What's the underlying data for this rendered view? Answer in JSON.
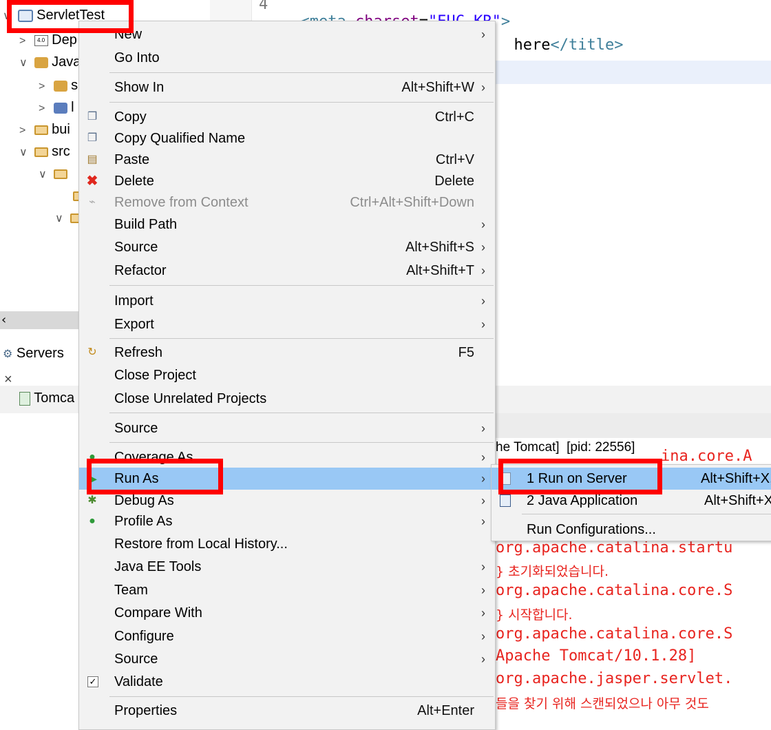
{
  "editor": {
    "line_number": "4",
    "line4_parts": [
      "<",
      "meta",
      " charset",
      "=",
      "\"EUC-KR\"",
      ">"
    ],
    "line5_parts": [
      "here",
      "</",
      "title",
      ">"
    ]
  },
  "tree": {
    "project": "ServletTest",
    "items": [
      {
        "label": "Dep",
        "chevron": ">"
      },
      {
        "label": "Java",
        "chevron": "∨"
      },
      {
        "label": "s",
        "chevron": ">"
      },
      {
        "label": "l",
        "chevron": ">"
      },
      {
        "label": "bui",
        "chevron": ">"
      },
      {
        "label": "src",
        "chevron": "∨"
      },
      {
        "label": "",
        "chevron": "∨"
      }
    ]
  },
  "servers_tab": {
    "label": "Servers",
    "close": "×"
  },
  "servers_view": {
    "item": "Tomca"
  },
  "console": {
    "header": "he Tomcat]  [pid: 22556]",
    "header_partial": "ina.core.A",
    "lines": [
      {
        "text": "org.apache.catalina.startu",
        "ko": false
      },
      {
        "text": "} 초기화되었습니다.",
        "ko": true
      },
      {
        "text": "org.apache.catalina.core.S",
        "ko": false
      },
      {
        "text": "} 시작합니다.",
        "ko": true
      },
      {
        "text": "org.apache.catalina.core.S",
        "ko": false
      },
      {
        "text": "Apache Tomcat/10.1.28]",
        "ko": false
      },
      {
        "text": "org.apache.jasper.servlet.",
        "ko": false
      },
      {
        "text": "들을 찾기 위해 스캔되었으나 아무 것도",
        "ko": true
      }
    ]
  },
  "context_menu": {
    "items": [
      {
        "label": "New",
        "shortcut": "",
        "submenu": true
      },
      {
        "label": "Go Into",
        "shortcut": "",
        "submenu": false
      },
      {
        "label": "Show In",
        "shortcut": "Alt+Shift+W",
        "submenu": true
      },
      {
        "label": "Copy",
        "shortcut": "Ctrl+C",
        "submenu": false,
        "icon": "copy-icon"
      },
      {
        "label": "Copy Qualified Name",
        "shortcut": "",
        "submenu": false,
        "icon": "copy-qualified-name-icon"
      },
      {
        "label": "Paste",
        "shortcut": "Ctrl+V",
        "submenu": false,
        "icon": "paste-icon"
      },
      {
        "label": "Delete",
        "shortcut": "Delete",
        "submenu": false,
        "icon": "delete-icon"
      },
      {
        "label": "Remove from Context",
        "shortcut": "Ctrl+Alt+Shift+Down",
        "submenu": false,
        "disabled": true,
        "icon": "remove-from-context-icon"
      },
      {
        "label": "Build Path",
        "shortcut": "",
        "submenu": true
      },
      {
        "label": "Source",
        "shortcut": "Alt+Shift+S",
        "submenu": true
      },
      {
        "label": "Refactor",
        "shortcut": "Alt+Shift+T",
        "submenu": true
      },
      {
        "label": "Import",
        "shortcut": "",
        "submenu": true
      },
      {
        "label": "Export",
        "shortcut": "",
        "submenu": true
      },
      {
        "label": "Refresh",
        "shortcut": "F5",
        "submenu": false,
        "icon": "refresh-icon"
      },
      {
        "label": "Close Project",
        "shortcut": "",
        "submenu": false
      },
      {
        "label": "Close Unrelated Projects",
        "shortcut": "",
        "submenu": false
      },
      {
        "label": "Source",
        "shortcut": "",
        "submenu": true
      },
      {
        "label": "Coverage As",
        "shortcut": "",
        "submenu": true,
        "icon": "coverage-icon"
      },
      {
        "label": "Run As",
        "shortcut": "",
        "submenu": true,
        "icon": "run-icon",
        "active": true
      },
      {
        "label": "Debug As",
        "shortcut": "",
        "submenu": true,
        "icon": "debug-icon"
      },
      {
        "label": "Profile As",
        "shortcut": "",
        "submenu": true,
        "icon": "profile-icon"
      },
      {
        "label": "Restore from Local History...",
        "shortcut": "",
        "submenu": false
      },
      {
        "label": "Java EE Tools",
        "shortcut": "",
        "submenu": true
      },
      {
        "label": "Team",
        "shortcut": "",
        "submenu": true
      },
      {
        "label": "Compare With",
        "shortcut": "",
        "submenu": true
      },
      {
        "label": "Configure",
        "shortcut": "",
        "submenu": true
      },
      {
        "label": "Source",
        "shortcut": "",
        "submenu": true
      },
      {
        "label": "Validate",
        "shortcut": "",
        "submenu": false,
        "icon": "check-icon"
      },
      {
        "label": "Properties",
        "shortcut": "Alt+Enter",
        "submenu": false
      }
    ],
    "arrow_glyph": "›"
  },
  "run_as_submenu": {
    "items": [
      {
        "label": "1 Run on Server",
        "shortcut": "Alt+Shift+X, R",
        "active": true
      },
      {
        "label": "2 Java Application",
        "shortcut": "Alt+Shift+X, J"
      },
      {
        "label": "Run Configurations...",
        "shortcut": ""
      }
    ]
  },
  "colors": {
    "highlight": "#99c8f5",
    "annotation_red": "#ff0000",
    "console_red": "#e8241f",
    "menu_bg": "#f2f2f2"
  }
}
